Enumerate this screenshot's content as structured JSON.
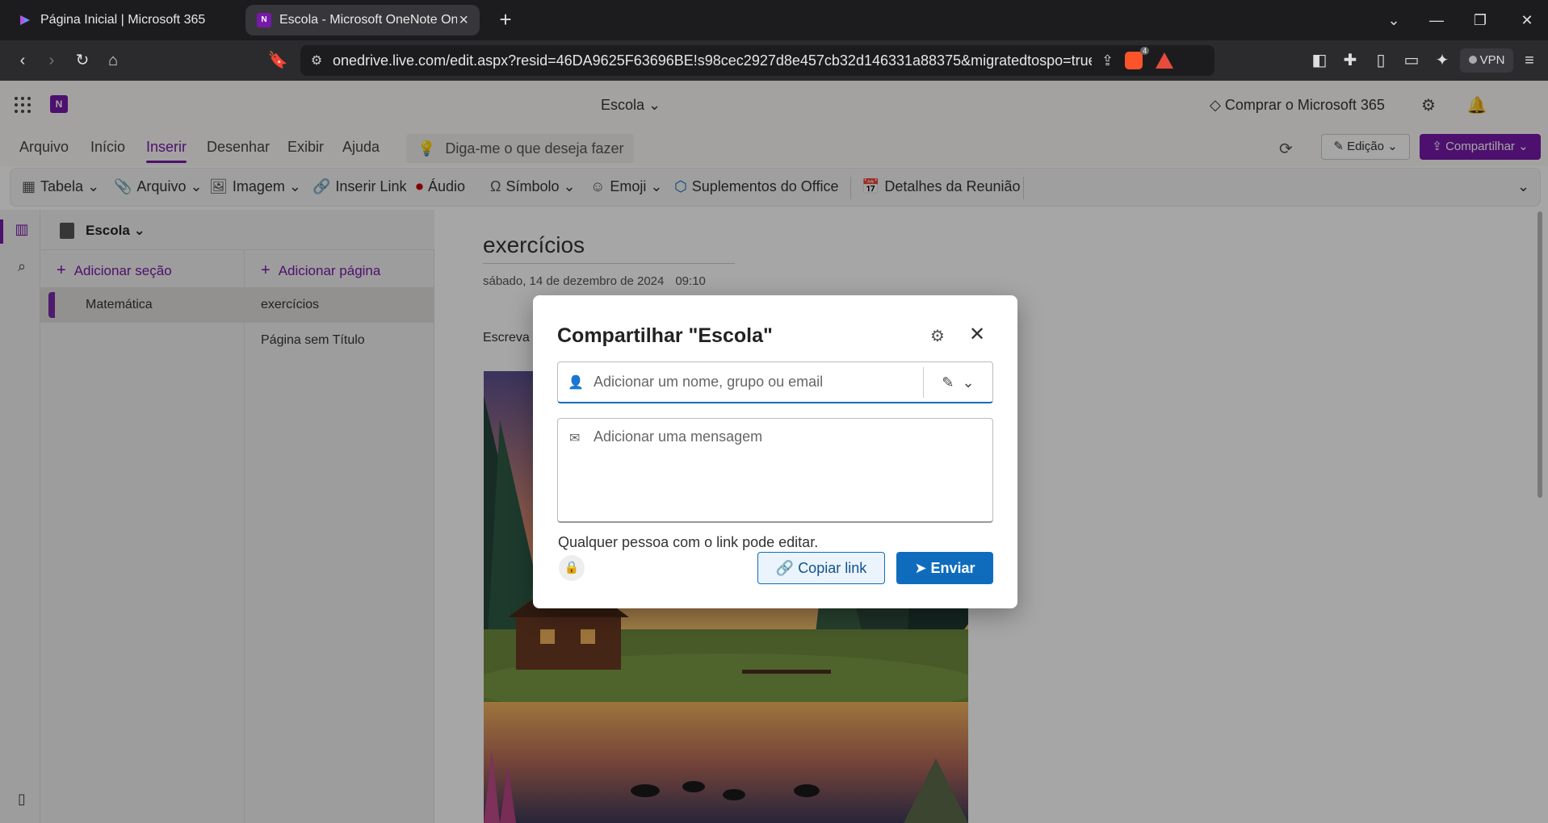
{
  "browser": {
    "tabs": [
      {
        "title": "Página Inicial | Microsoft 365",
        "active": false
      },
      {
        "title": "Escola - Microsoft OneNote Online",
        "active": true
      }
    ],
    "url": "onedrive.live.com/edit.aspx?resid=46DA9625F63696BE!s98cec2927d8e457cb32d146331a88375&migratedtospo=true&...",
    "brave_shield_count": "4",
    "vpn_label": "VPN"
  },
  "app": {
    "doc_title": "Escola",
    "buy_label": "Comprar o Microsoft 365",
    "menu": [
      "Arquivo",
      "Início",
      "Inserir",
      "Desenhar",
      "Exibir",
      "Ajuda"
    ],
    "active_menu": "Inserir",
    "tell_me": "Diga-me o que deseja fazer",
    "edit_mode": "Edição",
    "share_label": "Compartilhar",
    "ribbon": {
      "table": "Tabela",
      "file": "Arquivo",
      "image": "Imagem",
      "link": "Inserir Link",
      "audio": "Áudio",
      "symbol": "Símbolo",
      "emoji": "Emoji",
      "addins": "Suplementos do Office",
      "meeting": "Detalhes da Reunião"
    }
  },
  "notebook": {
    "name": "Escola",
    "add_section": "Adicionar seção",
    "add_page": "Adicionar página",
    "sections": [
      "Matemática"
    ],
    "pages": [
      "exercícios",
      "Página sem Título"
    ]
  },
  "page": {
    "title": "exercícios",
    "date": "sábado, 14 de dezembro de 2024",
    "time": "09:10",
    "text_partial": "Escreva"
  },
  "dialog": {
    "title": "Compartilhar \"Escola\"",
    "to_placeholder": "Adicionar um nome, grupo ou email",
    "message_placeholder": "Adicionar uma mensagem",
    "link_info": "Qualquer pessoa com o link pode editar.",
    "copy_link": "Copiar link",
    "send": "Enviar"
  }
}
